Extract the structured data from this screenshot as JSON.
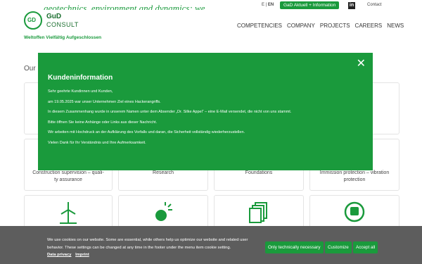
{
  "header": {
    "tagline_partial": "geotechnics, environment and dynamics: we",
    "lang_other": "E",
    "lang_active": "EN",
    "aktuell_button": "GaD Aktuell + Information",
    "linkedin_label": "in",
    "contact_link": "Contact",
    "brand_line1": "GuD",
    "brand_line2": "CONSULT",
    "slogan": "Weltoffen Vielfältig Aufgeschlossen",
    "nav": [
      "COMPETENCIES",
      "COMPANY",
      "PROJECTS",
      "CAREERS",
      "NEWS"
    ]
  },
  "main": {
    "section_heading": "Our",
    "cards_row2": [
      {
        "label_line1": "Construction supervision – quali-",
        "label_line2": "ty assurance"
      },
      {
        "label_line1": "Research",
        "label_line2": ""
      },
      {
        "label_line1": "Foundations",
        "label_line2": ""
      },
      {
        "label_line1": "Immission protection – vibration",
        "label_line2": "protection"
      }
    ],
    "bottom_icons": [
      "wind-turbine-icon",
      "explosion-icon",
      "documents-icon",
      "train-icon"
    ]
  },
  "modal": {
    "title": "Kundeninformation",
    "close": "✕",
    "lines": [
      "Sehr geehrte Kundinnen und Kunden,",
      "am 19.05.2025 war unser Unternehmen Ziel eines Hackerangriffs.",
      "In diesem Zusammenhang wurde in unserem Namen unter dem Absender „Dr. Silke Appel“ – eine E-Mail versendet, die nicht von uns stammt.",
      "Bitte öffnen Sie keine Anhänge oder Links aus dieser Nachricht.",
      "Wir arbeiten mit Hochdruck an der Aufklärung des Vorfalls und daran, die Sicherheit vollständig wiederherzustellen.",
      "Vielen Dank für Ihr Verständnis und Ihre Aufmerksamkeit."
    ]
  },
  "cookie": {
    "text": "We use cookies on our website. Some are essential, while others help us optimize our website and related user behavior. These settings can be changed at any time in the footer under the menu item cookie setting.",
    "privacy": "Data privacy",
    "imprint": "Imprint",
    "btn_technical": "Only technically necessary",
    "btn_customize": "Customize",
    "btn_accept": "Accept all"
  }
}
